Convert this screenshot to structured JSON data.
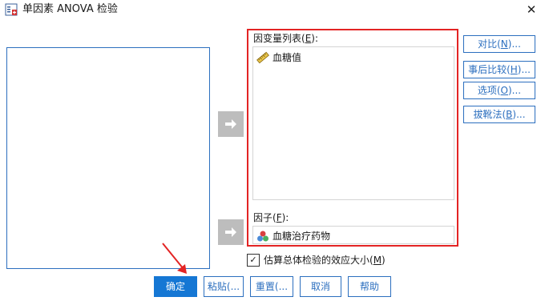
{
  "window": {
    "title": "单因素 ANOVA 检验",
    "icons": {
      "app": "app-window-icon",
      "close": "close-icon"
    }
  },
  "dependent": {
    "label_pre": "因变量列表(",
    "label_key": "E",
    "label_post": "):",
    "items": [
      {
        "label": "血糖值",
        "icon": "ruler-scale-icon"
      }
    ]
  },
  "factor": {
    "label_pre": "因子(",
    "label_key": "F",
    "label_post": "):",
    "value": "血糖治疗药物",
    "icon": "nominal-variable-icon"
  },
  "side_buttons": [
    {
      "pre": "对比(",
      "key": "N",
      "post": ")..."
    },
    {
      "pre": "事后比较(",
      "key": "H",
      "post": ")..."
    },
    {
      "pre": "选项(",
      "key": "O",
      "post": ")..."
    },
    {
      "pre": "拔靴法(",
      "key": "B",
      "post": ")..."
    }
  ],
  "checkbox": {
    "checked": true,
    "label_pre": "估算总体检验的效应大小(",
    "label_key": "M",
    "label_post": ")"
  },
  "bottom_buttons": [
    {
      "label": "确定"
    },
    {
      "label": "粘贴(..."
    },
    {
      "label": "重置(..."
    },
    {
      "label": "取消"
    },
    {
      "label": "帮助"
    }
  ],
  "colors": {
    "accent": "#2c6fbf",
    "primary_button": "#1577d4",
    "highlight_frame": "#e32424",
    "arrow_button": "#bdbdbd"
  }
}
